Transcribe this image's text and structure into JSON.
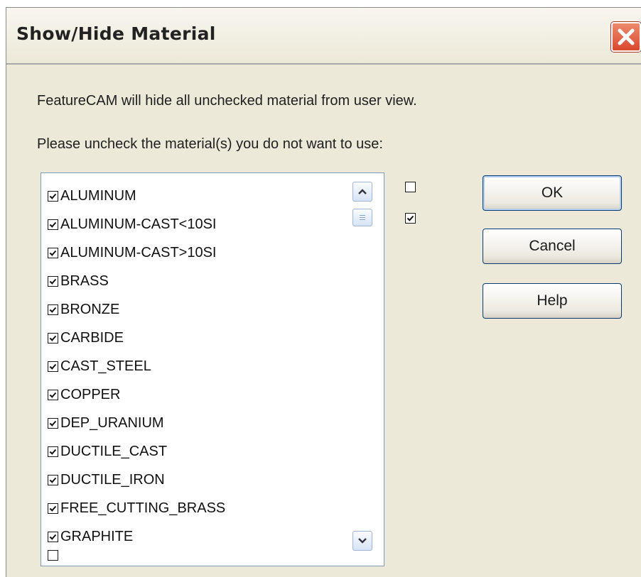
{
  "window": {
    "title": "Show/Hide Material"
  },
  "info": {
    "line1": "FeatureCAM will hide all unchecked material from user view.",
    "line2": "Please uncheck the material(s) you do not want to use:"
  },
  "materials": [
    {
      "label": "ALUMINUM",
      "checked": true
    },
    {
      "label": "ALUMINUM-CAST<10SI",
      "checked": true
    },
    {
      "label": "ALUMINUM-CAST>10SI",
      "checked": true
    },
    {
      "label": "BRASS",
      "checked": true
    },
    {
      "label": "BRONZE",
      "checked": true
    },
    {
      "label": "CARBIDE",
      "checked": true
    },
    {
      "label": "CAST_STEEL",
      "checked": true
    },
    {
      "label": "COPPER",
      "checked": true
    },
    {
      "label": "DEP_URANIUM",
      "checked": true
    },
    {
      "label": "DUCTILE_CAST",
      "checked": true
    },
    {
      "label": "DUCTILE_IRON",
      "checked": true
    },
    {
      "label": "FREE_CUTTING_BRASS",
      "checked": true
    },
    {
      "label": "GRAPHITE",
      "checked": true
    }
  ],
  "select_toggles": {
    "uncheck_all_checked": false,
    "check_all_checked": true
  },
  "buttons": {
    "ok": "OK",
    "cancel": "Cancel",
    "help": "Help"
  },
  "icons": {
    "close": "close-icon",
    "scroll_up": "chevron-up-icon",
    "scroll_down": "chevron-down-icon",
    "scroll_thumb": "grip-icon"
  }
}
